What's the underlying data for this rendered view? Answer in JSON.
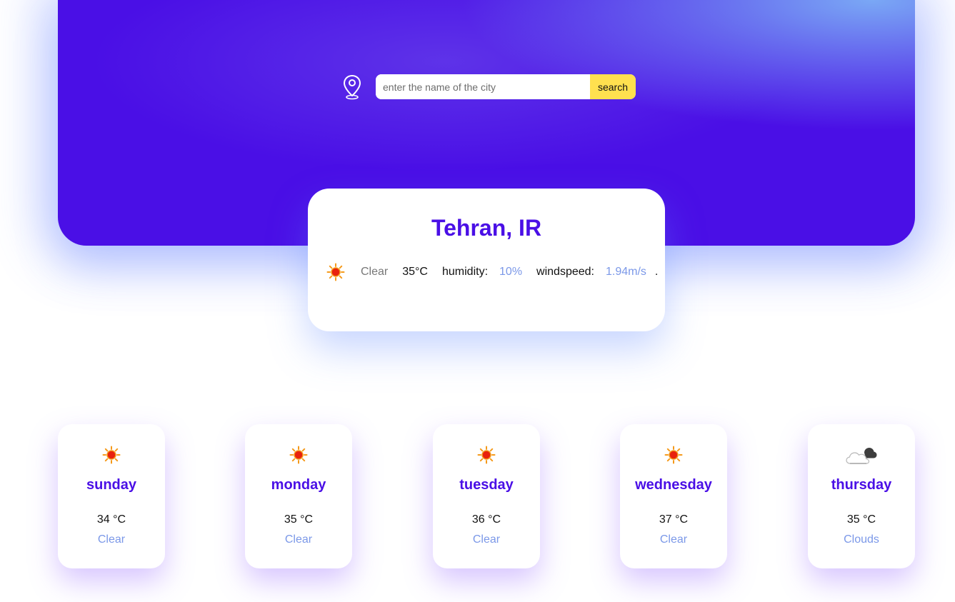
{
  "search": {
    "placeholder": "enter the name of the city",
    "button_label": "search",
    "icon": "location-pin-icon"
  },
  "current": {
    "city": "Tehran, IR",
    "icon": "sun-icon",
    "description": "Clear",
    "temperature": "35°C",
    "humidity_label": "humidity:",
    "humidity_value": "10%",
    "windspeed_label": "windspeed:",
    "windspeed_value": "1.94m/s",
    "trailing": "."
  },
  "forecast": [
    {
      "day": "sunday",
      "temp": "34 °C",
      "description": "Clear",
      "icon": "sun-icon"
    },
    {
      "day": "monday",
      "temp": "35 °C",
      "description": "Clear",
      "icon": "sun-icon"
    },
    {
      "day": "tuesday",
      "temp": "36 °C",
      "description": "Clear",
      "icon": "sun-icon"
    },
    {
      "day": "wednesday",
      "temp": "37 °C",
      "description": "Clear",
      "icon": "sun-icon"
    },
    {
      "day": "thursday",
      "temp": "35 °C",
      "description": "Clouds",
      "icon": "cloud-icon"
    }
  ],
  "colors": {
    "hero_primary": "#4a0fe6",
    "hero_accent": "#7aa8f5",
    "search_button": "#ffe04f",
    "value_text": "#7b98e8"
  }
}
